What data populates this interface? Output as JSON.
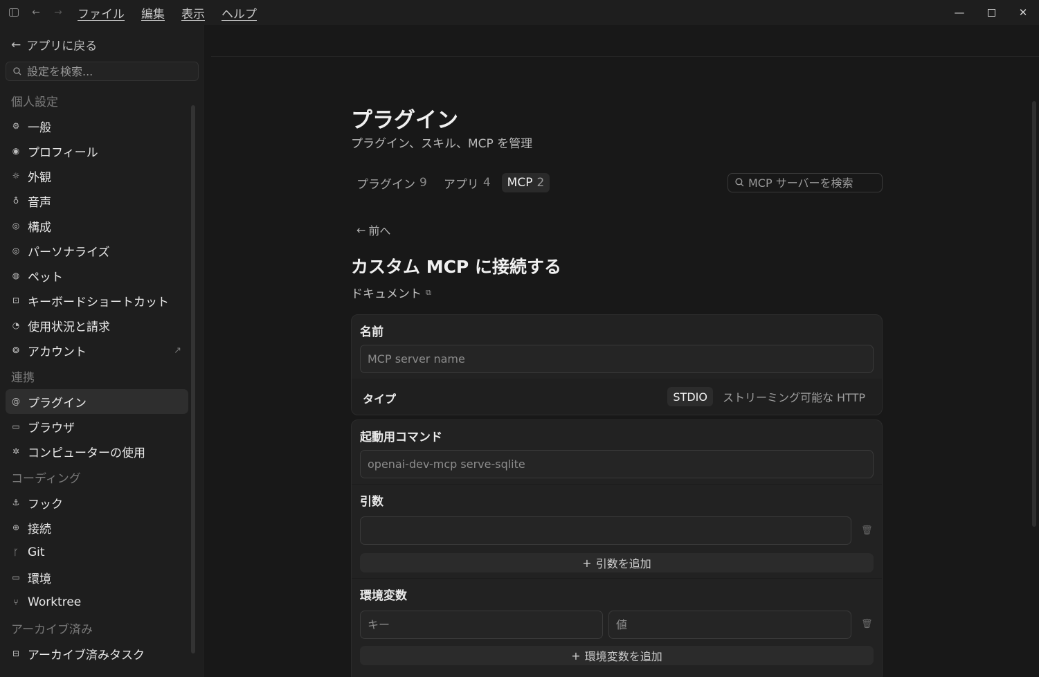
{
  "menu": [
    "ファイル",
    "編集",
    "表示",
    "ヘルプ"
  ],
  "sidebar": {
    "back_label": "アプリに戻る",
    "search_placeholder": "設定を検索...",
    "sections": [
      {
        "title": "個人設定",
        "items": [
          {
            "label": "一般",
            "icon": "gear-icon"
          },
          {
            "label": "プロフィール",
            "icon": "user-icon"
          },
          {
            "label": "外観",
            "icon": "sun-icon"
          },
          {
            "label": "音声",
            "icon": "mic-icon"
          },
          {
            "label": "構成",
            "icon": "config-icon"
          },
          {
            "label": "パーソナライズ",
            "icon": "personalize-icon"
          },
          {
            "label": "ペット",
            "icon": "pet-icon"
          },
          {
            "label": "キーボードショートカット",
            "icon": "keyboard-icon"
          },
          {
            "label": "使用状況と請求",
            "icon": "gauge-icon"
          },
          {
            "label": "アカウント",
            "icon": "account-icon"
          }
        ]
      },
      {
        "title": "連携",
        "items": [
          {
            "label": "プラグイン",
            "icon": "plugin-icon"
          },
          {
            "label": "ブラウザ",
            "icon": "browser-icon"
          },
          {
            "label": "コンピューターの使用",
            "icon": "computer-use-icon"
          }
        ]
      },
      {
        "title": "コーディング",
        "items": [
          {
            "label": "フック",
            "icon": "anchor-icon"
          },
          {
            "label": "接続",
            "icon": "globe-icon"
          },
          {
            "label": "Git",
            "icon": "git-icon"
          },
          {
            "label": "環境",
            "icon": "environment-icon"
          },
          {
            "label": "Worktree",
            "icon": "worktree-icon"
          }
        ]
      },
      {
        "title": "アーカイブ済み",
        "items": [
          {
            "label": "アーカイブ済みタスク",
            "icon": "archive-icon"
          }
        ]
      }
    ]
  },
  "main": {
    "title": "プラグイン",
    "subtitle": "プラグイン、スキル、MCP を管理",
    "tabs": [
      {
        "label": "プラグイン",
        "count": "9"
      },
      {
        "label": "アプリ",
        "count": "4"
      },
      {
        "label": "MCP",
        "count": "2"
      }
    ],
    "active_tab": "MCP",
    "search_placeholder": "MCP サーバーを検索",
    "back_label": "前へ",
    "heading": "カスタム MCP に接続する",
    "doc_link": "ドキュメント",
    "form": {
      "name_label": "名前",
      "name_placeholder": "MCP server name",
      "type_label": "タイプ",
      "type_options": [
        "STDIO",
        "ストリーミング可能な HTTP"
      ],
      "type_selected": "STDIO",
      "command_label": "起動用コマンド",
      "command_placeholder": "openai-dev-mcp serve-sqlite",
      "args_label": "引数",
      "args_value": "",
      "add_arg_label": "引数を追加",
      "env_label": "環境変数",
      "env_key_placeholder": "キー",
      "env_value_placeholder": "値",
      "add_env_label": "環境変数を追加"
    }
  }
}
